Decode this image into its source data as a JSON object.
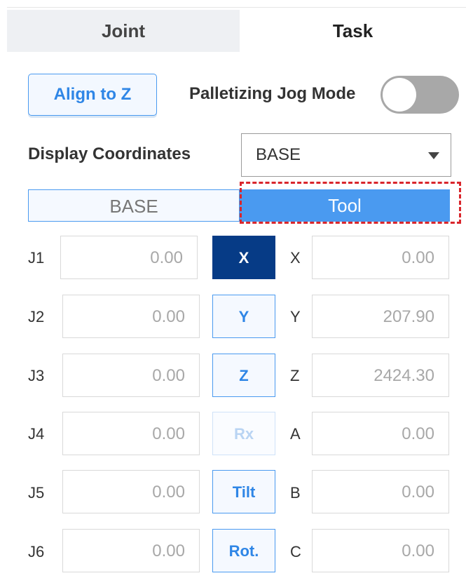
{
  "tabs": {
    "joint": "Joint",
    "task": "Task"
  },
  "controls": {
    "align_label": "Align to Z",
    "pallet_label": "Palletizing Jog Mode",
    "pallet_on": false,
    "display_label": "Display Coordinates",
    "display_value": "BASE"
  },
  "frame_toggle": {
    "base": "BASE",
    "tool": "Tool",
    "selected": "Tool"
  },
  "joints": [
    {
      "label": "J1",
      "value": "0.00"
    },
    {
      "label": "J2",
      "value": "0.00"
    },
    {
      "label": "J3",
      "value": "0.00"
    },
    {
      "label": "J4",
      "value": "0.00"
    },
    {
      "label": "J5",
      "value": "0.00"
    },
    {
      "label": "J6",
      "value": "0.00"
    }
  ],
  "axis_buttons": [
    "X",
    "Y",
    "Z",
    "Rx",
    "Tilt",
    "Rot."
  ],
  "coords": [
    {
      "label": "X",
      "value": "0.00"
    },
    {
      "label": "Y",
      "value": "207.90"
    },
    {
      "label": "Z",
      "value": "2424.30"
    },
    {
      "label": "A",
      "value": "0.00"
    },
    {
      "label": "B",
      "value": "0.00"
    },
    {
      "label": "C",
      "value": "0.00"
    }
  ]
}
